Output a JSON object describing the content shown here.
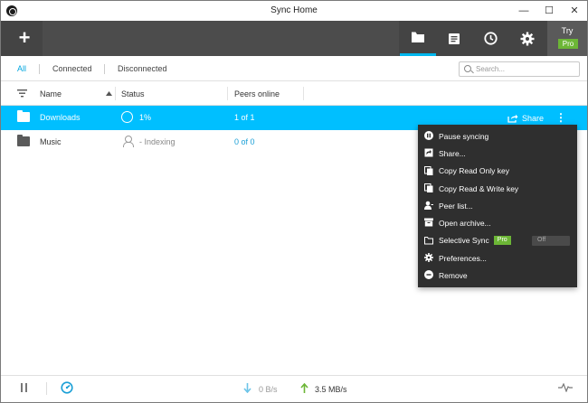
{
  "window": {
    "title": "Sync Home",
    "minimize": "—",
    "maximize": "☐",
    "close": "✕"
  },
  "toolbar": {
    "add_label": "+",
    "try_label": "Try",
    "pro_label": "Pro",
    "buttons": [
      {
        "icon": "folder-icon",
        "active": true
      },
      {
        "icon": "document-icon",
        "active": false
      },
      {
        "icon": "clock-icon",
        "active": false
      },
      {
        "icon": "gear-icon",
        "active": false
      }
    ],
    "accent_color": "#00b7ee"
  },
  "filters": {
    "tabs": [
      "All",
      "Connected",
      "Disconnected"
    ],
    "active": "All",
    "search_placeholder": "Search..."
  },
  "table": {
    "headers": {
      "name": "Name",
      "status": "Status",
      "peers": "Peers online"
    },
    "rows": [
      {
        "name": "Downloads",
        "status": "1%",
        "peers": "1 of 1",
        "selected": true,
        "folder_color": "#ffffff"
      },
      {
        "name": "Music",
        "status": "- Indexing",
        "peers": "0 of 0",
        "selected": false,
        "folder_color": "#5a5a5a"
      }
    ],
    "share_label": "Share",
    "more_label": "⋮"
  },
  "menu": {
    "items": [
      {
        "label": "Pause syncing",
        "icon": "pause-icon"
      },
      {
        "label": "Share...",
        "icon": "share-icon"
      },
      {
        "label": "Copy Read Only key",
        "icon": "copy-icon"
      },
      {
        "label": "Copy Read & Write key",
        "icon": "copy-icon"
      },
      {
        "label": "Peer list...",
        "icon": "person-icon"
      },
      {
        "label": "Open archive...",
        "icon": "archive-icon"
      },
      {
        "label": "Selective Sync",
        "icon": "folder-outline-icon"
      },
      {
        "label": "Preferences...",
        "icon": "gear-icon"
      },
      {
        "label": "Remove",
        "icon": "minus-circle-icon"
      }
    ],
    "selective_pro": "Pro",
    "selective_toggle": "Off"
  },
  "statusbar": {
    "download_speed": "0 B/s",
    "upload_speed": "3.5 MB/s"
  }
}
